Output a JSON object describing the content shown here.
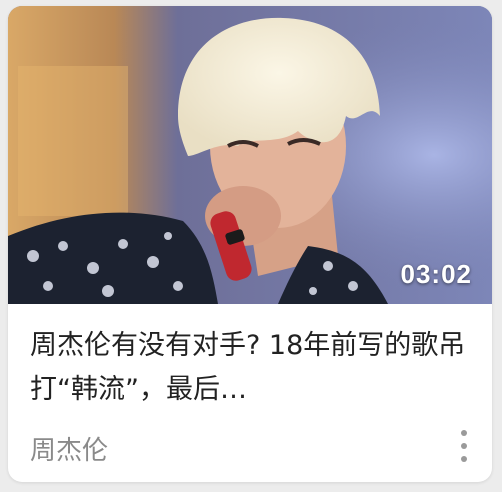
{
  "card": {
    "duration": "03:02",
    "title": "周杰伦有没有对手? 18年前写的歌吊打“韩流”，最后…",
    "author": "周杰伦"
  },
  "icons": {
    "more": "more-vertical-icon"
  }
}
